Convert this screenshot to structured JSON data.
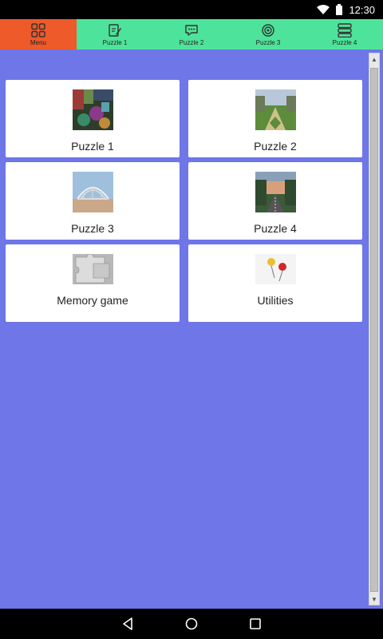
{
  "status_bar": {
    "time": "12:30",
    "icons": [
      "wifi-icon",
      "battery-icon"
    ]
  },
  "tabs": [
    {
      "label": "Menu",
      "icon": "grid-icon",
      "active": true
    },
    {
      "label": "Puzzle 1",
      "icon": "edit-icon",
      "active": false
    },
    {
      "label": "Puzzle 2",
      "icon": "chat-icon",
      "active": false
    },
    {
      "label": "Puzzle 3",
      "icon": "target-icon",
      "active": false
    },
    {
      "label": "Puzzle 4",
      "icon": "stack-icon",
      "active": false
    }
  ],
  "cards": [
    {
      "label": "Puzzle 1",
      "thumbnail": "abstract-colorful-image"
    },
    {
      "label": "Puzzle 2",
      "thumbnail": "park-path-image"
    },
    {
      "label": "Puzzle 3",
      "thumbnail": "bridge-image"
    },
    {
      "label": "Puzzle 4",
      "thumbnail": "sunset-road-image"
    },
    {
      "label": "Memory game",
      "thumbnail": "jigsaw-piece-image"
    },
    {
      "label": "Utilities",
      "thumbnail": "pushpins-image"
    }
  ],
  "colors": {
    "background": "#6e76e8",
    "tabbar": "#4ee39a",
    "active_tab": "#ee5a2a",
    "card": "#ffffff"
  },
  "navigation": [
    "back-icon",
    "home-icon",
    "recents-icon"
  ]
}
